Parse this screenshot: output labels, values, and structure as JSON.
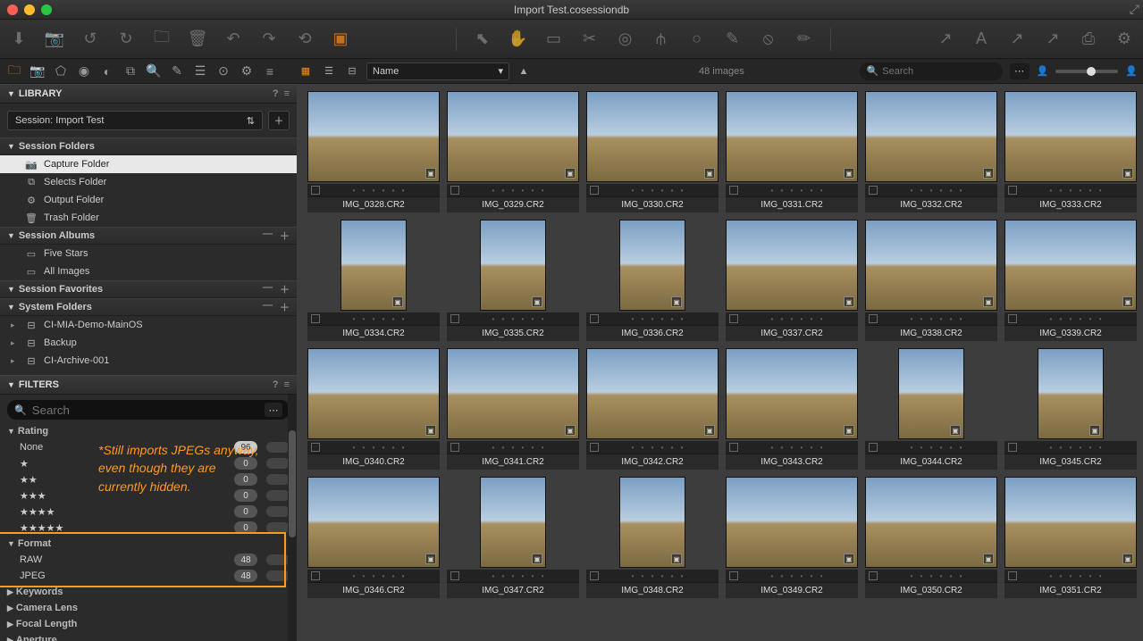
{
  "window": {
    "title": "Import Test.cosessiondb"
  },
  "sidebar": {
    "library_label": "LIBRARY",
    "session_selector": "Session: Import Test",
    "sections": {
      "session_folders": {
        "label": "Session Folders",
        "items": [
          "Capture Folder",
          "Selects Folder",
          "Output Folder",
          "Trash Folder"
        ]
      },
      "session_albums": {
        "label": "Session Albums",
        "items": [
          "Five Stars",
          "All Images"
        ]
      },
      "session_favorites": {
        "label": "Session Favorites"
      },
      "system_folders": {
        "label": "System Folders",
        "items": [
          "CI-MIA-Demo-MainOS",
          "Backup",
          "CI-Archive-001"
        ]
      }
    }
  },
  "filters": {
    "label": "FILTERS",
    "search_placeholder": "Search",
    "rating": {
      "label": "Rating",
      "none_label": "None",
      "counts": {
        "none": "96",
        "s1": "0",
        "s2": "0",
        "s3": "0",
        "s4": "0",
        "s5": "0"
      }
    },
    "format": {
      "label": "Format",
      "raw_label": "RAW",
      "raw_count": "48",
      "jpeg_label": "JPEG",
      "jpeg_count": "48"
    },
    "keywords_label": "Keywords",
    "camera_lens_label": "Camera Lens",
    "focal_length_label": "Focal Length",
    "aperture_label": "Aperture"
  },
  "annotation": "*Still imports JPEGs anyway, even though they are currently hidden.",
  "browser": {
    "sort_label": "Name",
    "count_label": "48 images",
    "search_placeholder": "Search",
    "files": [
      {
        "n": "IMG_0328.CR2",
        "o": "l"
      },
      {
        "n": "IMG_0329.CR2",
        "o": "l"
      },
      {
        "n": "IMG_0330.CR2",
        "o": "l"
      },
      {
        "n": "IMG_0331.CR2",
        "o": "l"
      },
      {
        "n": "IMG_0332.CR2",
        "o": "l"
      },
      {
        "n": "IMG_0333.CR2",
        "o": "l"
      },
      {
        "n": "IMG_0334.CR2",
        "o": "p"
      },
      {
        "n": "IMG_0335.CR2",
        "o": "p"
      },
      {
        "n": "IMG_0336.CR2",
        "o": "p"
      },
      {
        "n": "IMG_0337.CR2",
        "o": "l"
      },
      {
        "n": "IMG_0338.CR2",
        "o": "l"
      },
      {
        "n": "IMG_0339.CR2",
        "o": "l"
      },
      {
        "n": "IMG_0340.CR2",
        "o": "l"
      },
      {
        "n": "IMG_0341.CR2",
        "o": "l"
      },
      {
        "n": "IMG_0342.CR2",
        "o": "l"
      },
      {
        "n": "IMG_0343.CR2",
        "o": "l"
      },
      {
        "n": "IMG_0344.CR2",
        "o": "p"
      },
      {
        "n": "IMG_0345.CR2",
        "o": "p"
      },
      {
        "n": "IMG_0346.CR2",
        "o": "l"
      },
      {
        "n": "IMG_0347.CR2",
        "o": "p"
      },
      {
        "n": "IMG_0348.CR2",
        "o": "p"
      },
      {
        "n": "IMG_0349.CR2",
        "o": "l"
      },
      {
        "n": "IMG_0350.CR2",
        "o": "l"
      },
      {
        "n": "IMG_0351.CR2",
        "o": "l"
      }
    ]
  }
}
